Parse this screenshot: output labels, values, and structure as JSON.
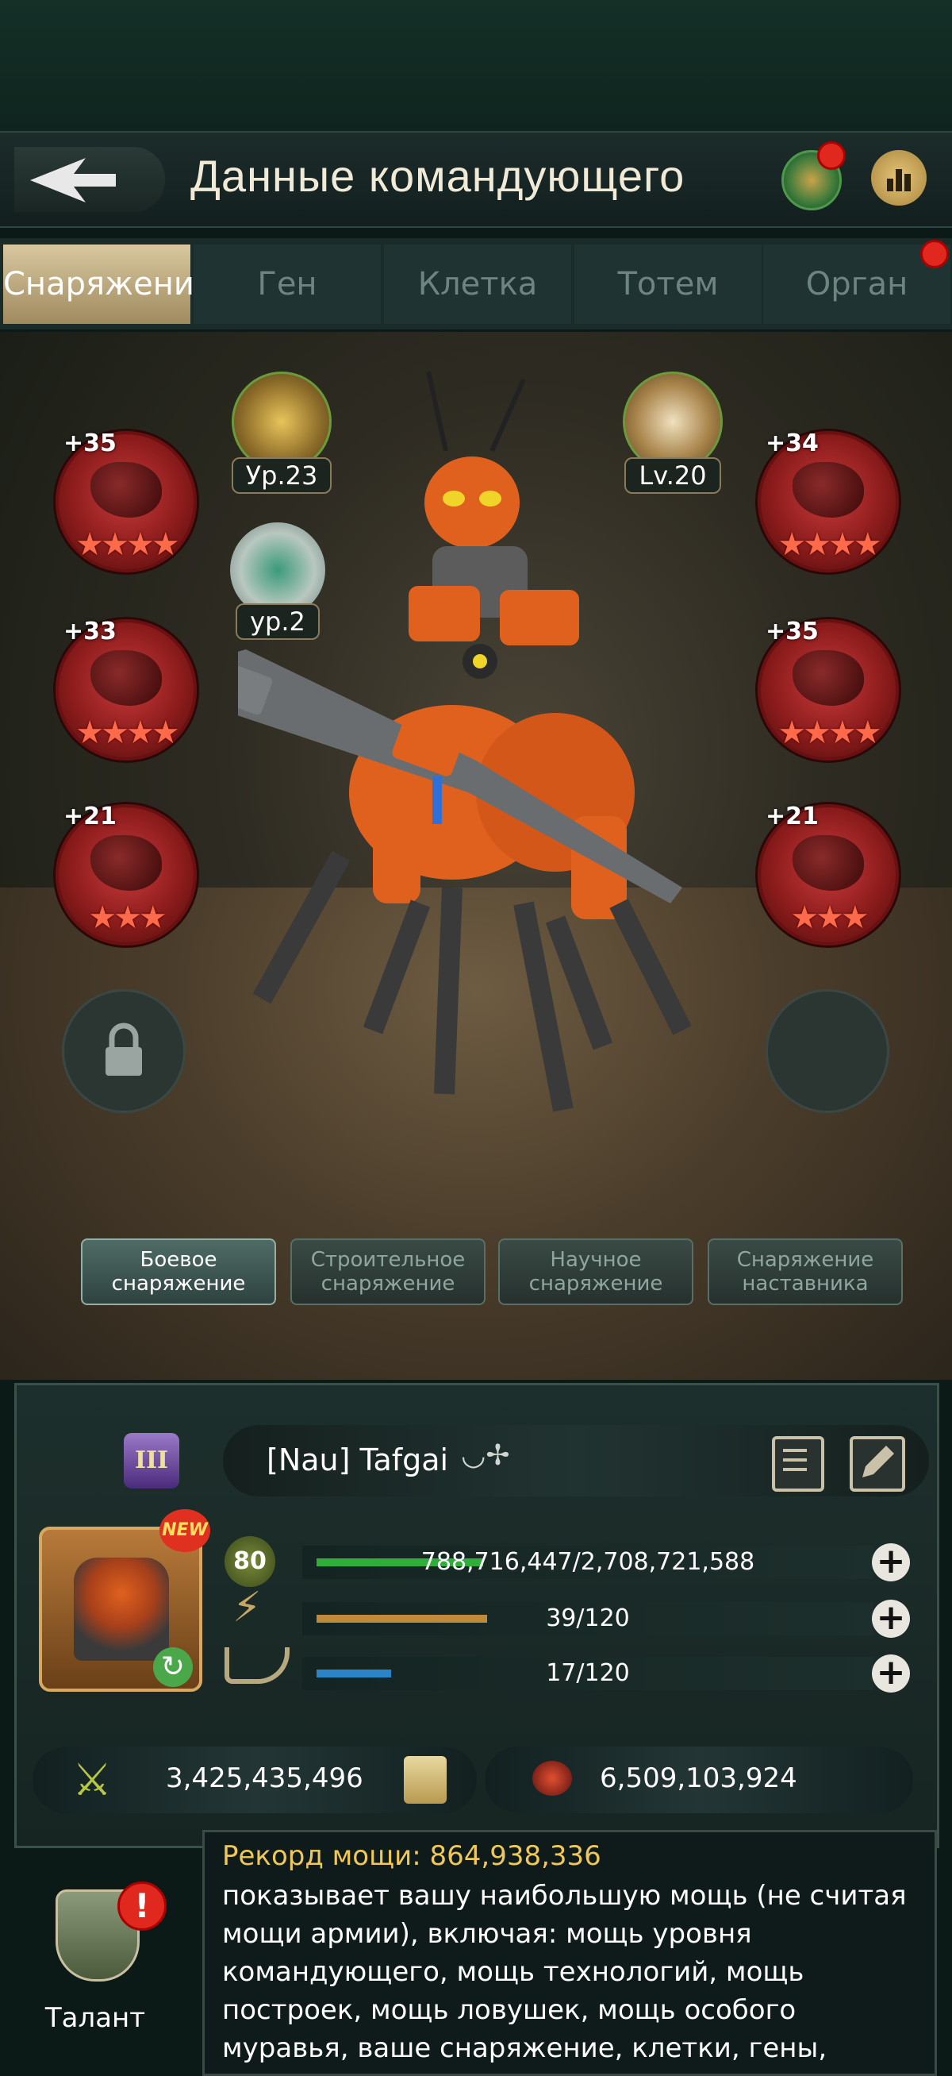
{
  "header": {
    "title": "Данные командующего"
  },
  "tabs": [
    {
      "label": "Снаряжение",
      "active": true
    },
    {
      "label": "Ген"
    },
    {
      "label": "Клетка"
    },
    {
      "label": "Тотем"
    },
    {
      "label": "Орган",
      "has_dot": true
    }
  ],
  "badges": {
    "rank_level": "Ур.23",
    "shield_level": "ур.2",
    "ant_level": "Lv.20"
  },
  "equipment": {
    "left": [
      {
        "level": "+35",
        "stars": "★★★★"
      },
      {
        "level": "+33",
        "stars": "★★★★"
      },
      {
        "level": "+21",
        "stars": "★★★"
      }
    ],
    "right": [
      {
        "level": "+34",
        "stars": "★★★★"
      },
      {
        "level": "+35",
        "stars": "★★★★"
      },
      {
        "level": "+21",
        "stars": "★★★"
      }
    ]
  },
  "subtabs": [
    {
      "line1": "Боевое",
      "line2": "снаряжение",
      "active": true
    },
    {
      "line1": "Строительное",
      "line2": "снаряжение"
    },
    {
      "line1": "Научное",
      "line2": "снаряжение"
    },
    {
      "line1": "Снаряжение",
      "line2": "наставника"
    }
  ],
  "profile": {
    "name": "[Nau]  Tafgai",
    "rank_numeral": "III",
    "new_badge": "NEW",
    "level": "80",
    "exp": "788,716,447/2,708,721,588",
    "exp_fraction": 0.291,
    "energy": "39/120",
    "energy_fraction": 0.325,
    "horn": "17/120",
    "horn_fraction": 0.142,
    "power": "3,425,435,496",
    "kills": "6,509,103,924"
  },
  "tooltip": {
    "title": "Рекорд мощи: 864,938,336",
    "body": "показывает вашу наибольшую мощь (не считая мощи армии), включая: мощь уровня командующего, мощь технологий, мощь построек, мощь ловушек, мощь особого муравья, ваше снаряжение, клетки, гены,"
  },
  "talent": {
    "label": "Талант"
  },
  "colors": {
    "exp_bar": "#2fae3a",
    "energy_bar": "#c08a3a",
    "horn_bar": "#2a84c8",
    "tooltip_title": "#f0c85a"
  }
}
